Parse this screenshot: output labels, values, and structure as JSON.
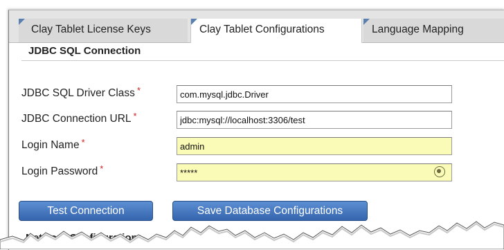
{
  "tabs": [
    {
      "label": "Clay Tablet License Keys",
      "active": false
    },
    {
      "label": "Clay Tablet Configurations",
      "active": true
    },
    {
      "label": "Language Mapping",
      "active": false
    }
  ],
  "section": {
    "title": "JDBC SQL Connection"
  },
  "fields": [
    {
      "label": "JDBC SQL Driver Class",
      "value": "com.mysql.jdbc.Driver"
    },
    {
      "label": "JDBC Connection URL",
      "value": "jdbc:mysql://localhost:3306/test"
    },
    {
      "label": "Login Name",
      "value": "admin"
    },
    {
      "label": "Login Password",
      "value": "*****"
    }
  ],
  "required_marker": "*",
  "buttons": {
    "test": "Test Connection",
    "save": "Save Database Configurations"
  },
  "next_section": {
    "title": "Network Configuration"
  },
  "colors": {
    "tab_notch": "#5a80b0",
    "button": "#3565ad",
    "required": "#cc2222",
    "autofill_bg": "#fbfbb8"
  }
}
